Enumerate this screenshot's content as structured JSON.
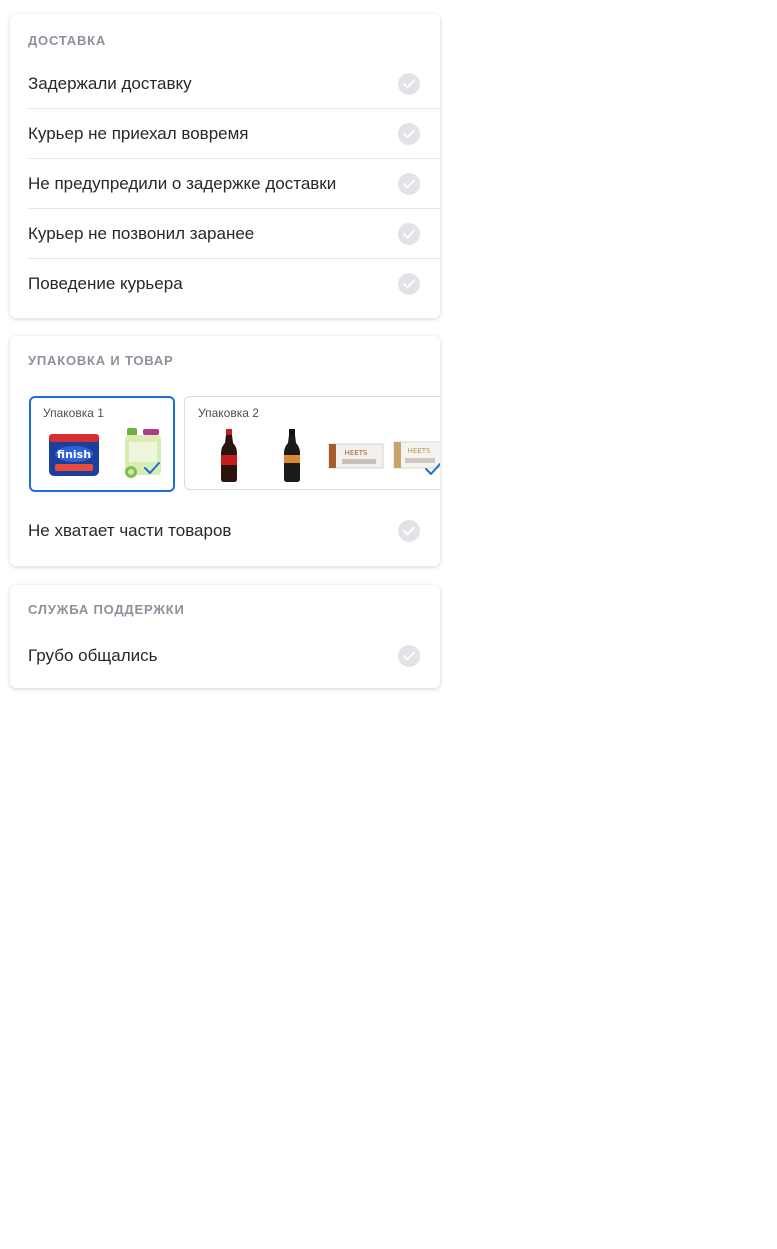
{
  "sections": {
    "delivery": {
      "title": "Доставка",
      "items": [
        {
          "label": "Задержали доставку",
          "checked": false
        },
        {
          "label": "Курьер не приехал вовремя",
          "checked": false
        },
        {
          "label": "Не предупредили о задержке доставки",
          "checked": false
        },
        {
          "label": "Курьер не позвонил заранее",
          "checked": false
        },
        {
          "label": "Поведение курьера",
          "checked": false
        }
      ]
    },
    "package": {
      "title": "Упаковка и товар",
      "packages": [
        {
          "label": "Упаковка 1",
          "selected": true,
          "products": [
            "finish-dishwasher-tablets",
            "green-detergent-canister"
          ]
        },
        {
          "label": "Упаковка 2",
          "selected": false,
          "products": [
            "cola-bottle",
            "dark-bottle",
            "heets-pack-bronze",
            "heets-pack-silver"
          ]
        }
      ],
      "items": [
        {
          "label": "Не хватает части товаров",
          "checked": false
        }
      ]
    },
    "support": {
      "title": "Служба поддержки",
      "items": [
        {
          "label": "Грубо общались",
          "checked": false
        }
      ]
    }
  },
  "colors": {
    "accent": "#1d6fd6",
    "check_inactive": "#e1e3e6",
    "section_title": "#8c919b"
  }
}
